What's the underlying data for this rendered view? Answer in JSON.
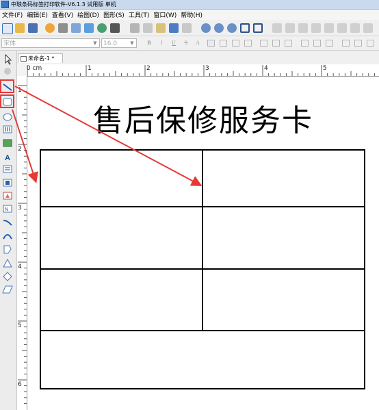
{
  "window": {
    "title": "中琅条码标签打印软件-V6.1.3 试用版 单机"
  },
  "menu": [
    {
      "label": "文件(F)"
    },
    {
      "label": "编辑(E)"
    },
    {
      "label": "查看(V)"
    },
    {
      "label": "绘图(D)"
    },
    {
      "label": "图形(S)"
    },
    {
      "label": "工具(T)"
    },
    {
      "label": "窗口(W)"
    },
    {
      "label": "帮助(H)"
    }
  ],
  "format_bar": {
    "font_value": "宋体",
    "size_value": "16.0",
    "bold": "B",
    "italic": "I",
    "underline": "U",
    "strike": "S"
  },
  "document": {
    "tab_label": "未命名-1 *"
  },
  "ruler": {
    "h_labels": [
      "0 cm",
      "1",
      "2",
      "3",
      "4",
      "5"
    ],
    "v_labels": [
      "1",
      "2",
      "3",
      "4",
      "5",
      "6"
    ]
  },
  "label": {
    "title": "售后保修服务卡"
  },
  "colors": {
    "highlight": "#e03a3a",
    "arrow": "#e53935"
  },
  "tools": [
    "select-pointer-icon",
    "hand-icon",
    "line-icon",
    "rounded-rectangle-icon",
    "ellipse-icon",
    "barcode-icon",
    "image-icon",
    "text-icon",
    "multiline-text-icon",
    "qrcode-icon",
    "shape-icon",
    "data-icon",
    "curve-line-icon",
    "arc-icon",
    "polygon-icon",
    "triangle-icon",
    "diamond-icon",
    "parallelogram-icon"
  ]
}
